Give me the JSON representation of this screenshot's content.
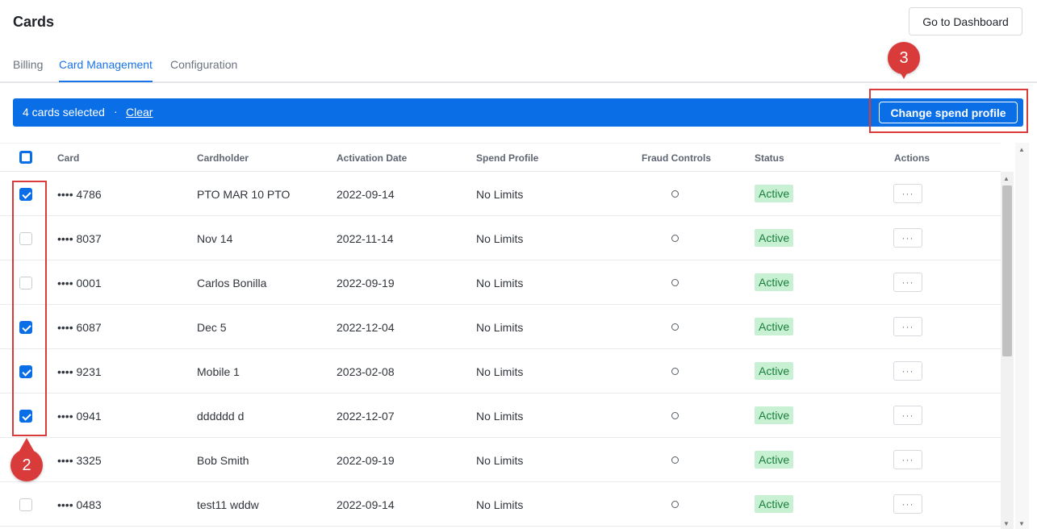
{
  "header": {
    "title": "Cards",
    "dashboard_button": "Go to Dashboard"
  },
  "tabs": [
    {
      "label": "Billing",
      "active": false
    },
    {
      "label": "Card Management",
      "active": true
    },
    {
      "label": "Configuration",
      "active": false
    }
  ],
  "selection_bar": {
    "count_text": "4 cards selected",
    "separator": "·",
    "clear_label": "Clear",
    "action_label": "Change spend profile",
    "color": "#0a6ee6"
  },
  "table": {
    "columns": [
      "Card",
      "Cardholder",
      "Activation Date",
      "Spend Profile",
      "Fraud Controls",
      "Status",
      "Actions"
    ],
    "rows": [
      {
        "checked": true,
        "card": "•••• 4786",
        "cardholder": "PTO MAR 10 PTO",
        "activation": "2022-09-14",
        "spend": "No Limits",
        "status": "Active",
        "actions": "···"
      },
      {
        "checked": false,
        "card": "•••• 8037",
        "cardholder": "Nov 14",
        "activation": "2022-11-14",
        "spend": "No Limits",
        "status": "Active",
        "actions": "···"
      },
      {
        "checked": false,
        "card": "•••• 0001",
        "cardholder": "Carlos Bonilla",
        "activation": "2022-09-19",
        "spend": "No Limits",
        "status": "Active",
        "actions": "···"
      },
      {
        "checked": true,
        "card": "•••• 6087",
        "cardholder": "Dec 5",
        "activation": "2022-12-04",
        "spend": "No Limits",
        "status": "Active",
        "actions": "···"
      },
      {
        "checked": true,
        "card": "•••• 9231",
        "cardholder": "Mobile 1",
        "activation": "2023-02-08",
        "spend": "No Limits",
        "status": "Active",
        "actions": "···"
      },
      {
        "checked": true,
        "card": "•••• 0941",
        "cardholder": "dddddd d",
        "activation": "2022-12-07",
        "spend": "No Limits",
        "status": "Active",
        "actions": "···"
      },
      {
        "checked": false,
        "card": "•••• 3325",
        "cardholder": "Bob Smith",
        "activation": "2022-09-19",
        "spend": "No Limits",
        "status": "Active",
        "actions": "···"
      },
      {
        "checked": false,
        "card": "•••• 0483",
        "cardholder": "test11 wddw",
        "activation": "2022-09-14",
        "spend": "No Limits",
        "status": "Active",
        "actions": "···"
      }
    ]
  },
  "annotations": [
    {
      "number": "2",
      "color": "#d93a3a"
    },
    {
      "number": "3",
      "color": "#d93a3a"
    }
  ],
  "icons": {
    "fraud": "circle-icon",
    "actions": "more-horizontal-icon",
    "scroll_up": "arrow-up-icon",
    "scroll_down": "arrow-down-icon"
  }
}
